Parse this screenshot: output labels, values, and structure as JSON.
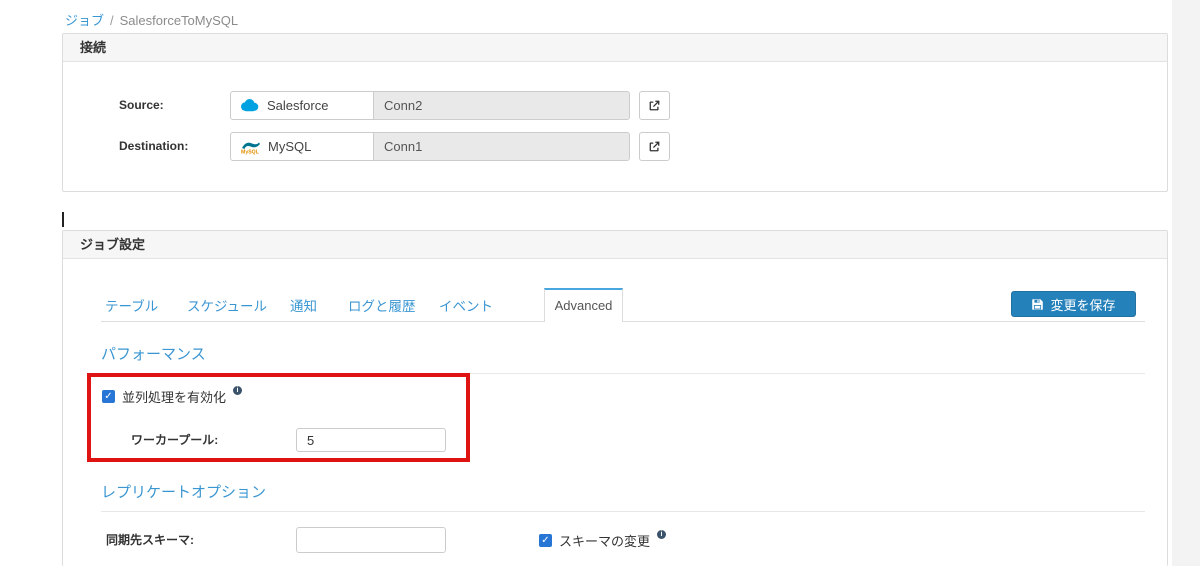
{
  "breadcrumb": {
    "parent_label": "ジョブ",
    "separator": "/",
    "current_label": "SalesforceToMySQL"
  },
  "connection_panel": {
    "title": "接続",
    "source": {
      "label": "Source:",
      "connector_name": "Salesforce",
      "connection_value": "Conn2"
    },
    "destination": {
      "label": "Destination:",
      "connector_name": "MySQL",
      "connection_value": "Conn1"
    }
  },
  "job_panel": {
    "title": "ジョブ設定",
    "tabs": [
      {
        "label": "テーブル",
        "active": false
      },
      {
        "label": "スケジュール",
        "active": false
      },
      {
        "label": "通知",
        "active": false
      },
      {
        "label": "ログと履歴",
        "active": false
      },
      {
        "label": "イベント",
        "active": false
      },
      {
        "label": "Advanced",
        "active": true
      }
    ],
    "save_button_label": "変更を保存",
    "performance": {
      "title": "パフォーマンス",
      "parallel_checkbox_label": "並列処理を有効化",
      "parallel_checkbox_checked": true,
      "worker_pool_label": "ワーカープール:",
      "worker_pool_value": "5"
    },
    "replicate": {
      "title": "レプリケートオプション",
      "schema_field_label": "同期先スキーマ:",
      "schema_field_value": "",
      "schema_changes_label": "スキーマの変更",
      "schema_changes_checked": true
    }
  },
  "colors": {
    "accent_blue": "#3a96d2",
    "save_button_blue": "#2581ba",
    "checkbox_blue": "#2776d6",
    "active_tab_border_blue": "#49a7e0",
    "highlight_red": "#e01313"
  }
}
